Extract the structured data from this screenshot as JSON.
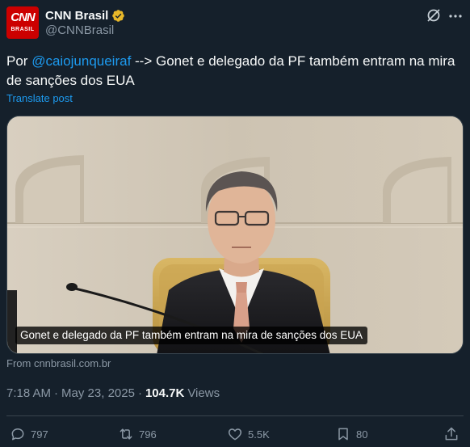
{
  "author": {
    "display_name": "CNN Brasil",
    "handle": "@CNNBrasil",
    "avatar_logo": "CNN",
    "avatar_sub": "BRASIL",
    "verified_color": "#e8b829"
  },
  "post": {
    "text_prefix": "Por ",
    "mention": "@caiojunqueiraf",
    "text_rest": " --> Gonet e delegado da PF também entram na mira de sanções dos EUA",
    "translate_label": "Translate post"
  },
  "media": {
    "caption": "Gonet e delegado da PF também entram na mira de sanções dos EUA"
  },
  "card": {
    "source": "From cnnbrasil.com.br"
  },
  "meta": {
    "time": "7:18 AM",
    "separator": "·",
    "date": "May 23, 2025",
    "views_count": "104.7K",
    "views_label": "Views"
  },
  "actions": {
    "replies": "797",
    "reposts": "796",
    "likes": "5.5K",
    "bookmarks": "80"
  },
  "colors": {
    "background": "#15202b",
    "accent": "#1d9bf0",
    "muted": "#8b98a5"
  }
}
